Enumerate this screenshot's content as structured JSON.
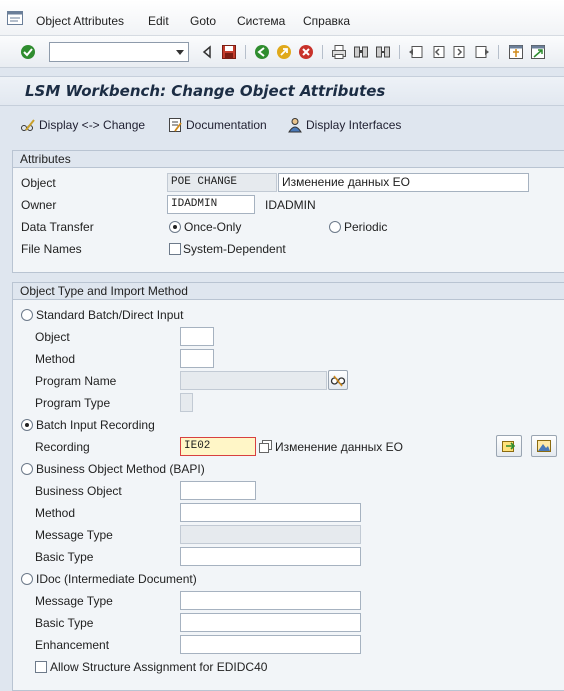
{
  "menu": {
    "items": [
      "Object Attributes",
      "Edit",
      "Goto",
      "Система",
      "Справка"
    ]
  },
  "toolbar": {
    "command_field_value": ""
  },
  "title": "LSM Workbench: Change Object Attributes",
  "app_toolbar": {
    "display_change": "Display <-> Change",
    "documentation": "Documentation",
    "display_interfaces": "Display Interfaces"
  },
  "attributes": {
    "group_title": "Attributes",
    "object_label": "Object",
    "object_value": "POE CHANGE",
    "object_description": "Изменение данных ЕО",
    "owner_label": "Owner",
    "owner_value": "IDADMIN",
    "owner_name": "IDADMIN",
    "data_transfer_label": "Data Transfer",
    "once_only_label": "Once-Only",
    "once_only_selected": true,
    "periodic_label": "Periodic",
    "periodic_selected": false,
    "file_names_label": "File Names",
    "system_dependent_label": "System-Dependent",
    "system_dependent_checked": false
  },
  "import_method": {
    "group_title": "Object Type and Import Method",
    "standard_batch_label": "Standard Batch/Direct Input",
    "standard_batch_selected": false,
    "sb_object_label": "Object",
    "sb_object_value": "",
    "sb_method_label": "Method",
    "sb_method_value": "",
    "sb_program_name_label": "Program Name",
    "sb_program_name_value": "",
    "sb_program_type_label": "Program Type",
    "sb_program_type_value": "",
    "batch_input_label": "Batch Input Recording",
    "batch_input_selected": true,
    "recording_label": "Recording",
    "recording_value": "IE02",
    "recording_description": "Изменение данных ЕО",
    "bapi_label": "Business Object Method  (BAPI)",
    "bapi_selected": false,
    "bapi_business_object_label": "Business Object",
    "bapi_business_object_value": "",
    "bapi_method_label": "Method",
    "bapi_method_value": "",
    "bapi_message_type_label": "Message Type",
    "bapi_message_type_value": "",
    "bapi_basic_type_label": "Basic Type",
    "bapi_basic_type_value": "",
    "idoc_label": "IDoc (Intermediate Document)",
    "idoc_selected": false,
    "idoc_message_type_label": "Message Type",
    "idoc_message_type_value": "",
    "idoc_basic_type_label": "Basic Type",
    "idoc_basic_type_value": "",
    "idoc_enhancement_label": "Enhancement",
    "idoc_enhancement_value": "",
    "allow_structure_label": "Allow Structure Assignment for EDIDC40",
    "allow_structure_checked": false
  },
  "colors": {
    "background": "#dfe6ef",
    "group_background": "#f2f5f8",
    "title_text": "#1c2d44",
    "focus_field": "#fff6c7"
  }
}
